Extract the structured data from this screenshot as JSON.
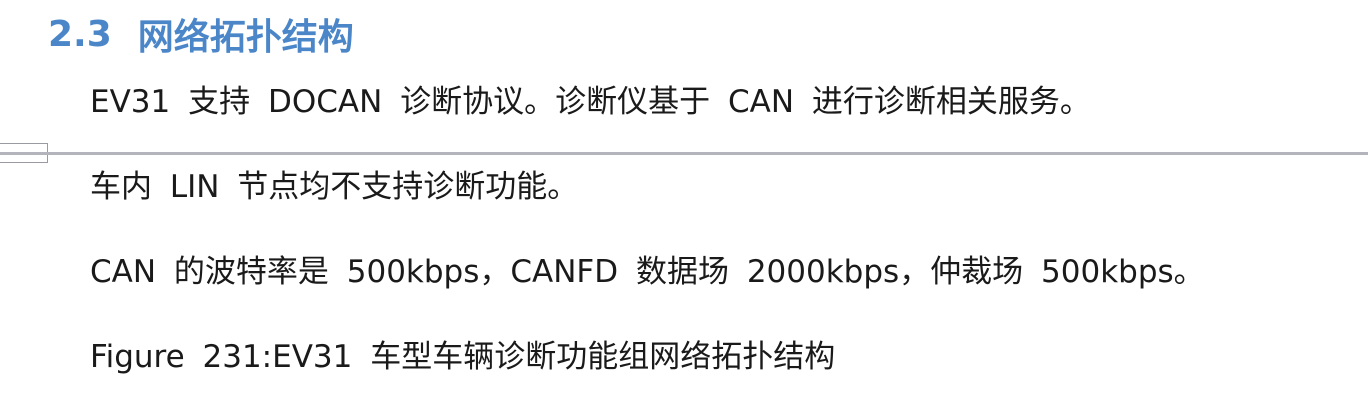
{
  "section": {
    "number": "2.3",
    "title": "网络拓扑结构"
  },
  "paragraphs": [
    "EV31 支持 DOCAN 诊断协议。诊断仪基于 CAN 进行诊断相关服务。",
    "车内 LIN 节点均不支持诊断功能。",
    "CAN 的波特率是 500kbps，CANFD 数据场 2000kbps，仲裁场 500kbps。"
  ],
  "figure_caption": "Figure 231:EV31 车型车辆诊断功能组网络拓扑结构",
  "colors": {
    "heading": "#4a86c8",
    "body_text": "#1a1a1a",
    "page_break_line": "#b4b4bc"
  }
}
